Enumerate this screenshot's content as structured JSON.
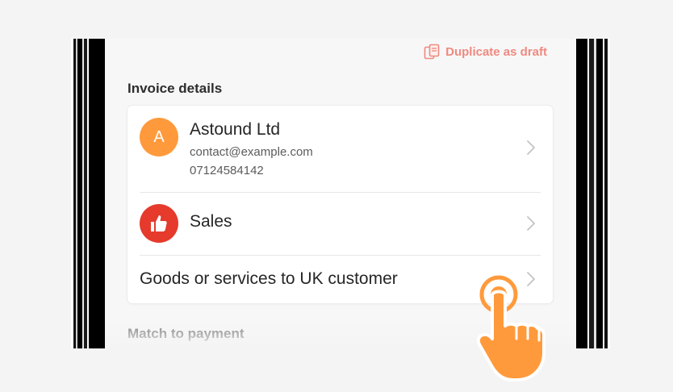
{
  "header": {
    "duplicate_label": "Duplicate as draft"
  },
  "invoice_details": {
    "title": "Invoice details",
    "contact": {
      "avatar_letter": "A",
      "name": "Astound Ltd",
      "email": "contact@example.com",
      "phone": "07124584142"
    },
    "category": {
      "label": "Sales"
    },
    "vat_type": {
      "label": "Goods or services to UK customer"
    }
  },
  "next_section": {
    "title": "Match to payment"
  },
  "colors": {
    "accent": "#ef8a80",
    "contact_avatar": "#ff9a3c",
    "sales_icon": "#e53a2c",
    "hand_cursor": "#ff9a3c"
  },
  "icons": {
    "duplicate": "duplicate-icon",
    "sales": "thumbs-up-icon",
    "chevron": "chevron-right-icon",
    "pointer": "hand-pointer-icon"
  }
}
